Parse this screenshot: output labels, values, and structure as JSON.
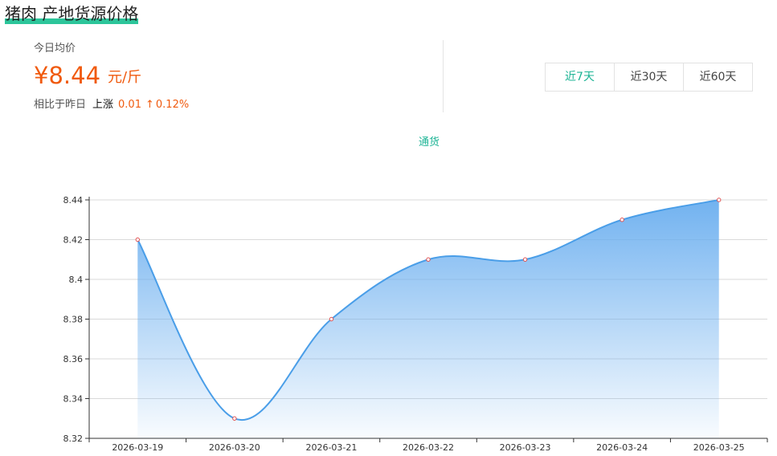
{
  "header": {
    "title": "猪肉 产地货源价格"
  },
  "price": {
    "label": "今日均价",
    "value": "¥8.44",
    "unit": "元/斤",
    "compare_label": "相比于昨日",
    "compare_direction": "上涨",
    "compare_change": "0.01",
    "compare_arrow": "↑",
    "compare_percent": "0.12%"
  },
  "range_tabs": [
    {
      "label": "近7天",
      "active": true
    },
    {
      "label": "近30天",
      "active": false
    },
    {
      "label": "近60天",
      "active": false
    }
  ],
  "colors": {
    "accent": "#1bb394",
    "price": "#f05a0e",
    "line": "#4a9ee8",
    "title_underline": "#2cc59a"
  },
  "chart_data": {
    "type": "area",
    "x": [
      "2026-03-19",
      "2026-03-20",
      "2026-03-21",
      "2026-03-22",
      "2026-03-23",
      "2026-03-24",
      "2026-03-25"
    ],
    "series": [
      {
        "name": "通货",
        "values": [
          8.42,
          8.33,
          8.38,
          8.41,
          8.41,
          8.43,
          8.44
        ]
      }
    ],
    "ylim": [
      8.32,
      8.44
    ],
    "yticks": [
      "8.32",
      "8.34",
      "8.36",
      "8.38",
      "8.4",
      "8.42",
      "8.44"
    ],
    "grid": true,
    "legend": "top-center",
    "smooth": true
  }
}
